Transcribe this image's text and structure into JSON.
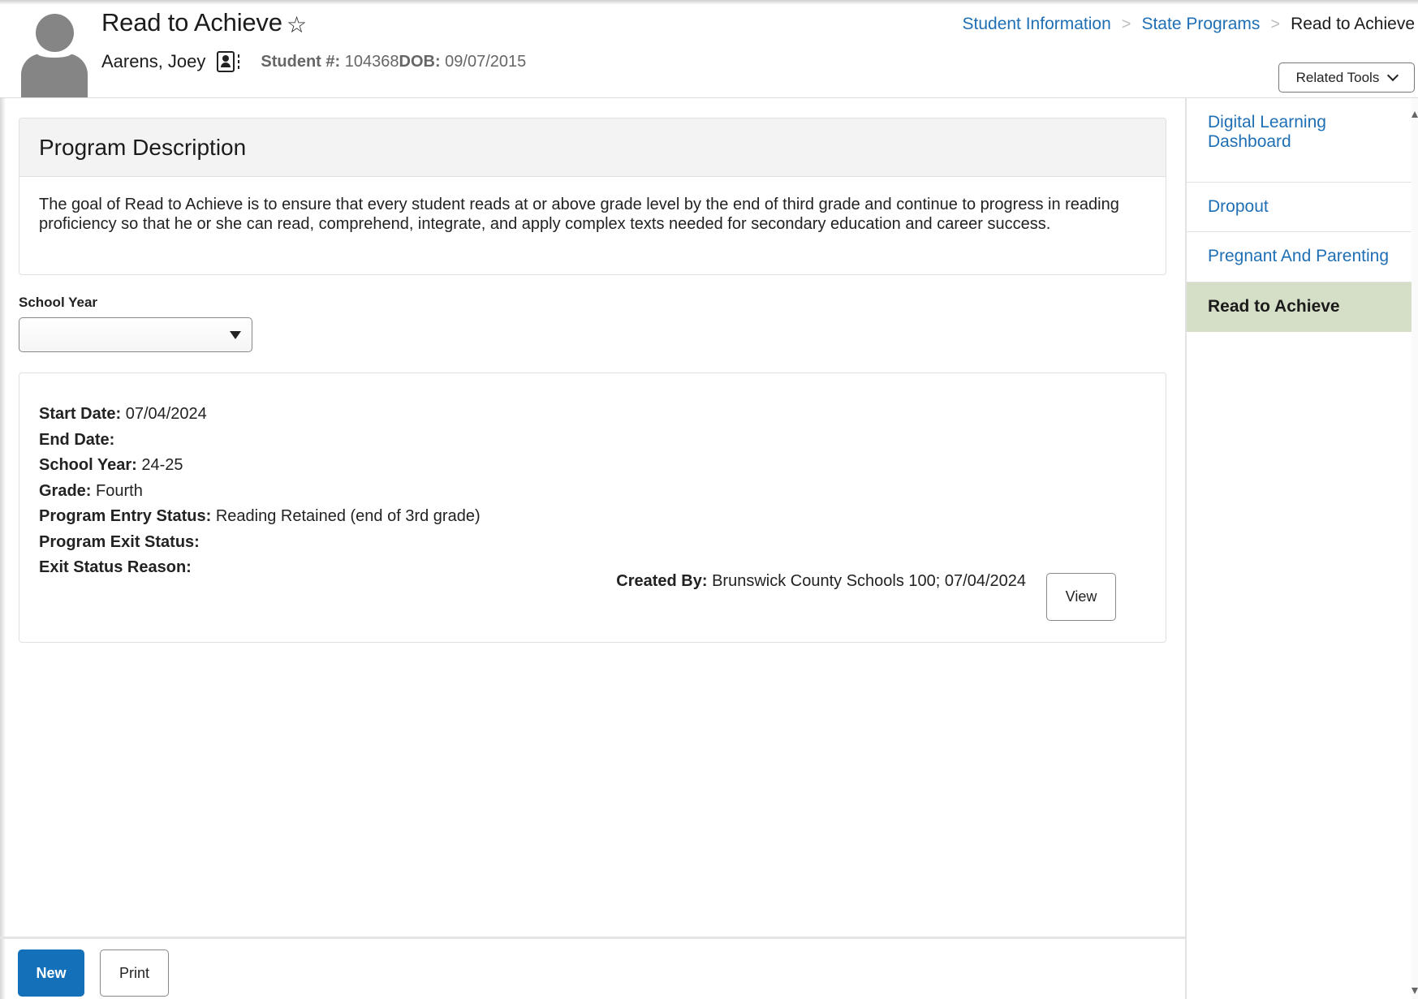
{
  "header": {
    "title": "Read to Achieve",
    "favorite_icon": "star-outline-icon",
    "student_name": "Aarens, Joey",
    "contact_icon": "contact-card-icon",
    "student_number_label": "Student #:",
    "student_number": "104368",
    "dob_label": "DOB:",
    "dob": "09/07/2015"
  },
  "breadcrumb": {
    "items": [
      "Student Information",
      "State Programs"
    ],
    "current": "Read to Achieve",
    "separator_icon": "chevron-right-icon"
  },
  "related_tools": {
    "label": "Related Tools",
    "icon": "chevron-down-icon"
  },
  "program_description": {
    "heading": "Program Description",
    "text": "The goal of Read to Achieve is to ensure that every student reads at or above grade level by the end of third grade and continue to progress in reading proficiency so that he or she can read, comprehend, integrate, and apply complex texts needed for secondary education and career success."
  },
  "school_year": {
    "label": "School Year",
    "selected": ""
  },
  "record": {
    "fields": [
      {
        "label": "Start Date:",
        "value": "07/04/2024"
      },
      {
        "label": "End Date:",
        "value": ""
      },
      {
        "label": "School Year:",
        "value": "24-25"
      },
      {
        "label": "Grade:",
        "value": "Fourth"
      },
      {
        "label": "Program Entry Status:",
        "value": "Reading Retained (end of 3rd grade)"
      },
      {
        "label": "Program Exit Status:",
        "value": ""
      },
      {
        "label": "Exit Status Reason:",
        "value": ""
      }
    ],
    "created_by_label": "Created By:",
    "created_by": "Brunswick County Schools 100; 07/04/2024",
    "view_label": "View"
  },
  "footer": {
    "new_label": "New",
    "print_label": "Print"
  },
  "sidebar": {
    "items": [
      {
        "label": "Digital Learning Dashboard",
        "active": false
      },
      {
        "label": "Dropout",
        "active": false
      },
      {
        "label": "Pregnant And Parenting",
        "active": false
      },
      {
        "label": "Read to Achieve",
        "active": true
      }
    ]
  },
  "colors": {
    "link": "#1f6fb5",
    "primary_button": "#1470b8",
    "active_sidebar": "#d5dec7",
    "avatar": "#858585"
  }
}
